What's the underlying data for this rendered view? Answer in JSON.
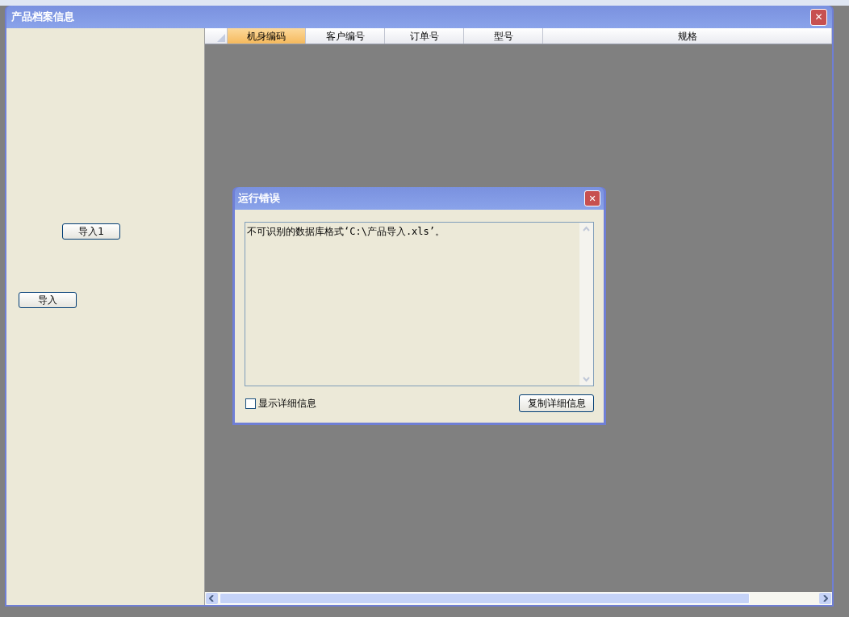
{
  "window": {
    "title": "产品档案信息",
    "close": "✕"
  },
  "left_panel": {
    "buttons": [
      {
        "label": "导入1"
      },
      {
        "label": "导入"
      }
    ]
  },
  "table": {
    "columns": [
      {
        "label": "机身编码",
        "selected": true
      },
      {
        "label": "客户编号",
        "selected": false
      },
      {
        "label": "订单号",
        "selected": false
      },
      {
        "label": "型号",
        "selected": false
      },
      {
        "label": "规格",
        "selected": false
      }
    ]
  },
  "dialog": {
    "title": "运行错误",
    "close": "✕",
    "message": "不可识别的数据库格式‘C:\\产品导入.xls’。",
    "show_details": {
      "label": "显示详细信息",
      "checked": false
    },
    "copy_button": "复制详细信息"
  }
}
